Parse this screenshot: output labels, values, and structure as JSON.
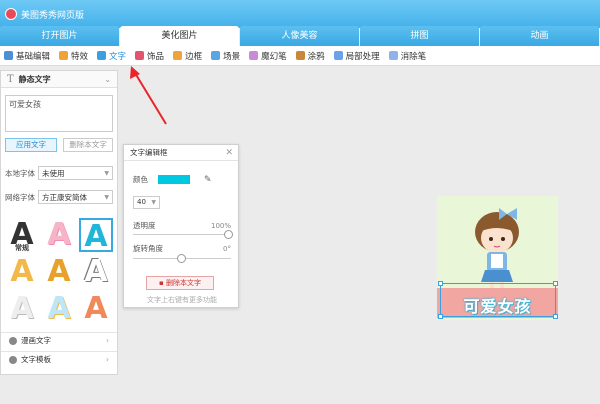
{
  "window": {
    "title": "美图秀秀网页版"
  },
  "tabs": [
    {
      "label": "打开图片",
      "active": false
    },
    {
      "label": "美化图片",
      "active": true
    },
    {
      "label": "人像美容",
      "active": false
    },
    {
      "label": "拼图",
      "active": false
    },
    {
      "label": "动画",
      "active": false
    }
  ],
  "toolbar": {
    "items": [
      {
        "label": "基础编辑",
        "icon": "edit-icon",
        "color": "#4b8fd6"
      },
      {
        "label": "特效",
        "icon": "magic-wand-icon",
        "color": "#f0a33a"
      },
      {
        "label": "文字",
        "icon": "text-icon",
        "color": "#3aa0e0",
        "active": true
      },
      {
        "label": "饰品",
        "icon": "bow-icon",
        "color": "#e2556c"
      },
      {
        "label": "边框",
        "icon": "frame-icon",
        "color": "#f0a33a"
      },
      {
        "label": "场景",
        "icon": "landscape-icon",
        "color": "#5aa6e0"
      },
      {
        "label": "魔幻笔",
        "icon": "pen-icon",
        "color": "#c98ad6"
      },
      {
        "label": "涂鸦",
        "icon": "brush-icon",
        "color": "#c9873a"
      },
      {
        "label": "局部处理",
        "icon": "local-edit-icon",
        "color": "#6aa1e8"
      },
      {
        "label": "消除笔",
        "icon": "eraser-icon",
        "color": "#8fb3e8"
      }
    ]
  },
  "left_panel": {
    "header": "静态文字",
    "text_value": "可爱女孩",
    "apply_button": "应用文字",
    "delete_button": "删除本文字",
    "local_font": {
      "label": "本地字体",
      "value": "未使用"
    },
    "web_font": {
      "label": "网络字体",
      "value": "方正康安简体"
    },
    "styles": [
      {
        "glyph": "A",
        "sub": "常规",
        "color": "#333"
      },
      {
        "glyph": "A",
        "sub": "",
        "color": "#f28fb0"
      },
      {
        "glyph": "A",
        "sub": "",
        "color": "#21b5d8",
        "selected": true
      },
      {
        "glyph": "A",
        "sub": "",
        "color": "#f2b84a"
      },
      {
        "glyph": "A",
        "sub": "",
        "color": "#e8a12a"
      },
      {
        "glyph": "A",
        "sub": "",
        "color": "#9a9a9a"
      },
      {
        "glyph": "A",
        "sub": "",
        "color": "#d8d8d8"
      },
      {
        "glyph": "A",
        "sub": "",
        "color": "#a6d8f0"
      },
      {
        "glyph": "A",
        "sub": "",
        "color": "#f08a5a"
      }
    ],
    "sections": [
      {
        "label": "漫画文字"
      },
      {
        "label": "文字模板"
      }
    ]
  },
  "dialog": {
    "title": "文字编辑框",
    "color_label": "颜色",
    "color_value": "#00c8e0",
    "size_value": "40",
    "opacity_label": "透明度",
    "opacity_value": "100%",
    "rotate_label": "旋转角度",
    "rotate_value": "0°",
    "delete_button": "删除本文字",
    "hint": "文字上右键有更多功能"
  },
  "canvas": {
    "caption": "可爱女孩"
  }
}
